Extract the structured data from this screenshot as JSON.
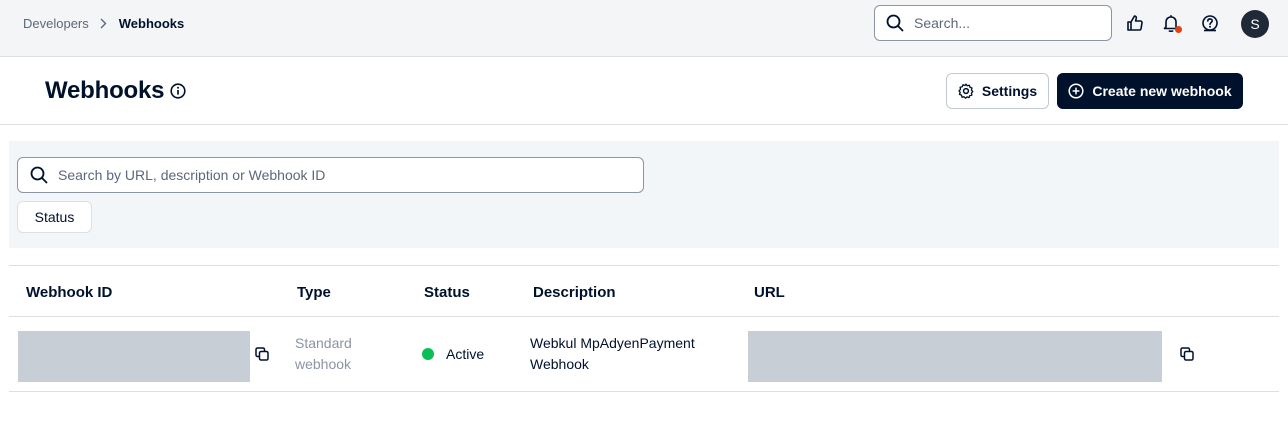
{
  "breadcrumb": {
    "parent": "Developers",
    "current": "Webhooks"
  },
  "top_search": {
    "placeholder": "Search..."
  },
  "user": {
    "avatar_initial": "S"
  },
  "page": {
    "title": "Webhooks"
  },
  "actions": {
    "settings_label": "Settings",
    "create_label": "Create new webhook"
  },
  "filters": {
    "search_placeholder": "Search by URL, description or Webhook ID",
    "status_label": "Status"
  },
  "table": {
    "columns": [
      "Webhook ID",
      "Type",
      "Status",
      "Description",
      "URL"
    ],
    "rows": [
      {
        "type": "Standard webhook",
        "status": "Active",
        "description": "Webkul MpAdyenPayment Webhook"
      }
    ]
  },
  "colors": {
    "primary": "#00112c",
    "active": "#0abf53",
    "notification": "#e5410f",
    "redacted": "#c7ced6"
  }
}
